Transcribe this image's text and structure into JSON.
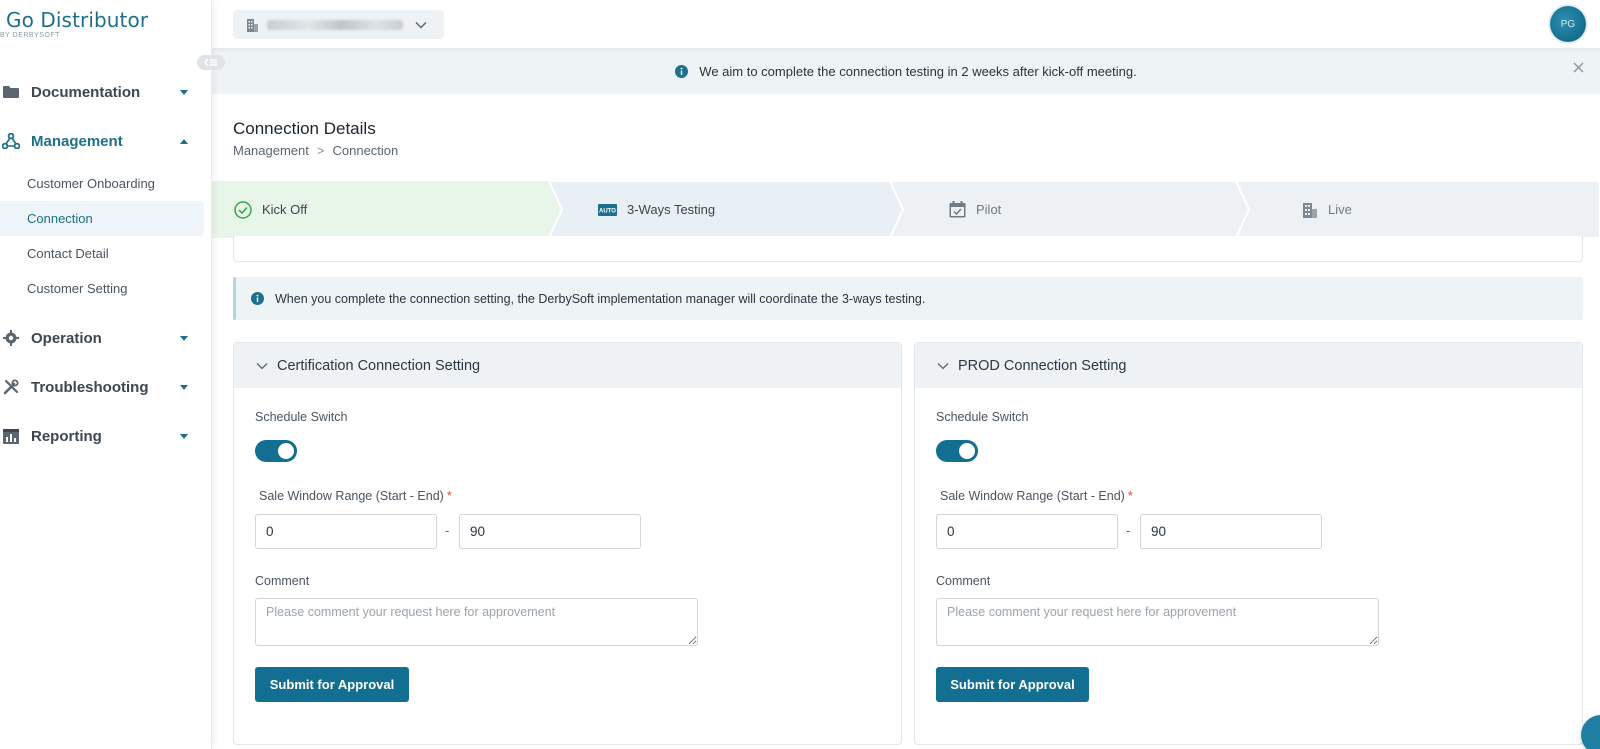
{
  "app": {
    "title": "Go Distributor",
    "subtitle": "BY DERBYSOFT"
  },
  "topbar": {
    "hotel_select_icon": "building-icon",
    "chevron": "chevron-down-icon",
    "avatar_initials": "PG"
  },
  "sidebar": {
    "groups": [
      {
        "label": "Documentation",
        "icon": "folder-icon",
        "open": false
      },
      {
        "label": "Management",
        "icon": "share-nodes-icon",
        "open": true,
        "items": [
          {
            "label": "Customer Onboarding",
            "active": false
          },
          {
            "label": "Connection",
            "active": true
          },
          {
            "label": "Contact Detail",
            "active": false
          },
          {
            "label": "Customer Setting",
            "active": false
          }
        ]
      },
      {
        "label": "Operation",
        "icon": "gear-icon",
        "open": false
      },
      {
        "label": "Troubleshooting",
        "icon": "tools-icon",
        "open": false
      },
      {
        "label": "Reporting",
        "icon": "report-icon",
        "open": false
      }
    ]
  },
  "banner": {
    "text": "We aim to complete the connection testing in 2 weeks after kick-off meeting."
  },
  "page": {
    "title": "Connection Details",
    "breadcrumb": [
      "Management",
      "Connection"
    ],
    "breadcrumb_sep": ">"
  },
  "steps": [
    {
      "label": "Kick Off",
      "icon": "check-circle-icon",
      "status": "done"
    },
    {
      "label": "3-Ways Testing",
      "icon": "auto-icon",
      "status": "current"
    },
    {
      "label": "Pilot",
      "icon": "calendar-check-icon",
      "status": "pending"
    },
    {
      "label": "Live",
      "icon": "building-icon",
      "status": "pending"
    }
  ],
  "notice": {
    "text": "When you complete the connection setting, the DerbySoft implementation manager will coordinate the 3-ways testing."
  },
  "panels": [
    {
      "title": "Certification Connection Setting",
      "schedule_label": "Schedule Switch",
      "schedule_on": true,
      "range_label": "Sale Window Range (Start - End)",
      "required_mark": "*",
      "start": "0",
      "range_sep": "-",
      "end": "90",
      "comment_label": "Comment",
      "comment_placeholder": "Please comment your request here for approvement",
      "submit_label": "Submit for Approval"
    },
    {
      "title": "PROD Connection Setting",
      "schedule_label": "Schedule Switch",
      "schedule_on": true,
      "range_label": "Sale Window Range (Start - End)",
      "required_mark": "*",
      "start": "0",
      "range_sep": "-",
      "end": "90",
      "comment_label": "Comment",
      "comment_placeholder": "Please comment your request here for approvement",
      "submit_label": "Submit for Approval"
    }
  ],
  "colors": {
    "primary": "#126f91",
    "brand": "#1e6f8d",
    "done_green": "#3aa64a",
    "required": "#e0453a"
  }
}
